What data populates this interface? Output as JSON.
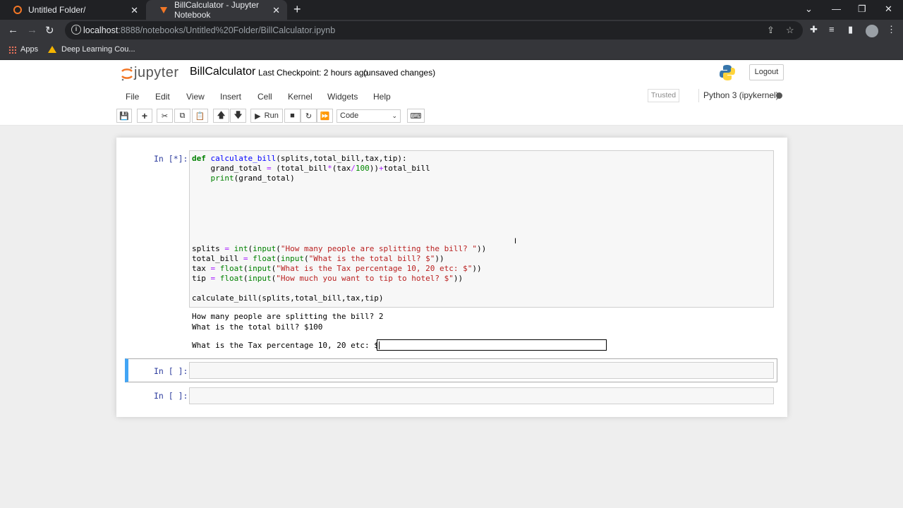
{
  "browser": {
    "tabs": [
      {
        "title": "Untitled Folder/",
        "close": "✕"
      },
      {
        "title": "BillCalculator - Jupyter Notebook",
        "close": "✕"
      }
    ],
    "new_tab": "+",
    "url_host": "localhost",
    "url_rest": ":8888/notebooks/Untitled%20Folder/BillCalculator.ipynb",
    "bookmarks": [
      "Apps",
      "Deep Learning Cou..."
    ]
  },
  "jupyter": {
    "logo_text": "jupyter",
    "notebook_name": "BillCalculator",
    "checkpoint": "Last Checkpoint: 2 hours ago",
    "unsaved": "(unsaved changes)",
    "logout": "Logout",
    "menu": [
      "File",
      "Edit",
      "View",
      "Insert",
      "Cell",
      "Kernel",
      "Widgets",
      "Help"
    ],
    "trusted": "Trusted",
    "kernel_name": "Python 3 (ipykernel)",
    "run_label": "Run",
    "cell_type": "Code"
  },
  "cells": [
    {
      "prompt": "In [*]:"
    },
    {
      "prompt": "In [ ]:"
    },
    {
      "prompt": "In [ ]:"
    }
  ],
  "output": {
    "line1": "How many people are splitting the bill? 2",
    "line2": "What is the total bill? $100",
    "line3": "What is the Tax percentage 10, 20 etc: $"
  }
}
